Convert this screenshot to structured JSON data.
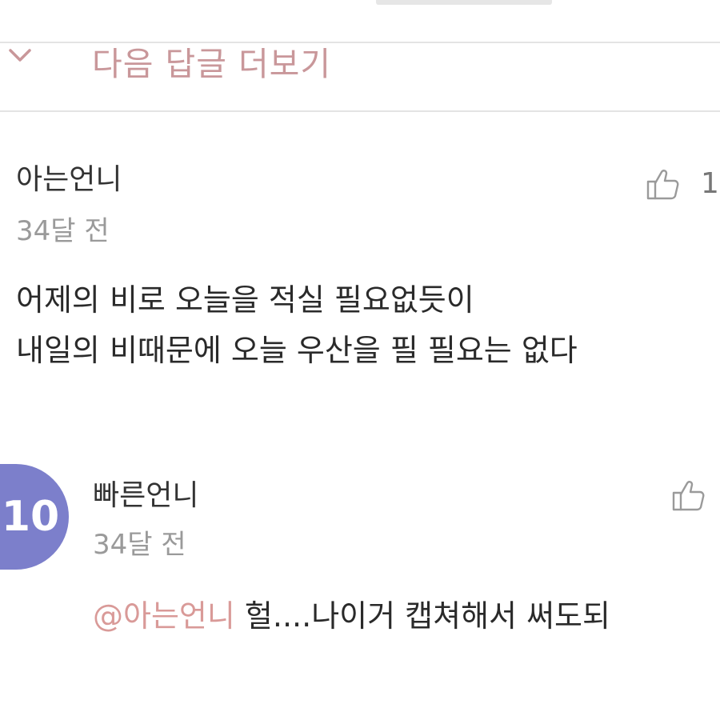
{
  "more_replies": {
    "label": "다음 답글 더보기",
    "icon": "chevron-down-icon",
    "color": "#c9979a"
  },
  "comments": [
    {
      "username": "아는언니",
      "timestamp": "34달 전",
      "like_icon": "thumbs-up-icon",
      "like_count": "1",
      "lines": [
        "어제의 비로 오늘을 적실 필요없듯이",
        "내일의 비때문에 오늘 우산을 필 필요는 없다"
      ]
    },
    {
      "username": "빠른언니",
      "timestamp": "34달 전",
      "avatar_text": "10",
      "avatar_color": "#7c7fcb",
      "like_icon": "thumbs-up-icon",
      "mention": "@아는언니",
      "text": " 헐....나이거 캡쳐해서 써도되"
    }
  ]
}
